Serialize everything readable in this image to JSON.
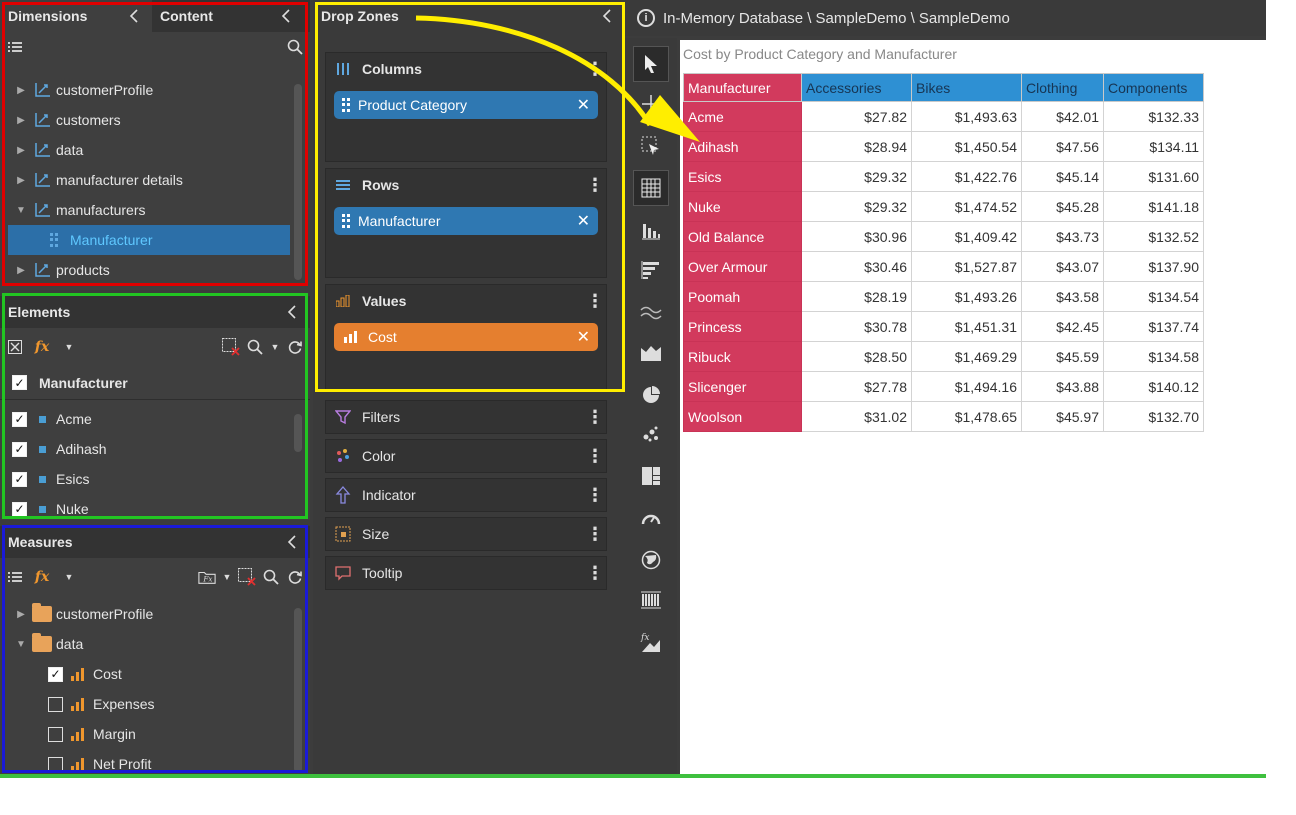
{
  "dimensions": {
    "tab_dimensions": "Dimensions",
    "tab_content": "Content",
    "tree": [
      {
        "label": "customerProfile",
        "expanded": false
      },
      {
        "label": "customers",
        "expanded": false
      },
      {
        "label": "data",
        "expanded": false
      },
      {
        "label": "manufacturer details",
        "expanded": false
      },
      {
        "label": "manufacturers",
        "expanded": true
      },
      {
        "label": "Manufacturer",
        "child": true,
        "selected": true
      },
      {
        "label": "products",
        "expanded": false
      }
    ]
  },
  "elements": {
    "title": "Elements",
    "header_label": "Manufacturer",
    "items": [
      "Acme",
      "Adihash",
      "Esics",
      "Nuke"
    ]
  },
  "measures": {
    "title": "Measures",
    "tree": [
      {
        "label": "customerProfile",
        "type": "folder"
      },
      {
        "label": "data",
        "type": "folder"
      },
      {
        "label": "Cost",
        "type": "measure",
        "checked": true
      },
      {
        "label": "Expenses",
        "type": "measure",
        "checked": false
      },
      {
        "label": "Margin",
        "type": "measure",
        "checked": false
      },
      {
        "label": "Net Profit",
        "type": "measure",
        "checked": false
      }
    ]
  },
  "dropzones": {
    "title": "Drop Zones",
    "columns": {
      "label": "Columns",
      "pill": "Product Category"
    },
    "rows": {
      "label": "Rows",
      "pill": "Manufacturer"
    },
    "values": {
      "label": "Values",
      "pill": "Cost"
    },
    "slots": [
      "Filters",
      "Color",
      "Indicator",
      "Size",
      "Tooltip"
    ]
  },
  "canvas": {
    "breadcrumb": "In-Memory Database \\ SampleDemo \\ SampleDemo",
    "report_title": "Cost by Product Category and Manufacturer"
  },
  "chart_data": {
    "type": "table",
    "title": "Cost by Product Category and Manufacturer",
    "row_header": "Manufacturer",
    "columns": [
      "Accessories",
      "Bikes",
      "Clothing",
      "Components"
    ],
    "rows": [
      {
        "label": "Acme",
        "values": [
          "$27.82",
          "$1,493.63",
          "$42.01",
          "$132.33"
        ]
      },
      {
        "label": "Adihash",
        "values": [
          "$28.94",
          "$1,450.54",
          "$47.56",
          "$134.11"
        ]
      },
      {
        "label": "Esics",
        "values": [
          "$29.32",
          "$1,422.76",
          "$45.14",
          "$131.60"
        ]
      },
      {
        "label": "Nuke",
        "values": [
          "$29.32",
          "$1,474.52",
          "$45.28",
          "$141.18"
        ]
      },
      {
        "label": "Old Balance",
        "values": [
          "$30.96",
          "$1,409.42",
          "$43.73",
          "$132.52"
        ]
      },
      {
        "label": "Over Armour",
        "values": [
          "$30.46",
          "$1,527.87",
          "$43.07",
          "$137.90"
        ]
      },
      {
        "label": "Poomah",
        "values": [
          "$28.19",
          "$1,493.26",
          "$43.58",
          "$134.54"
        ]
      },
      {
        "label": "Princess",
        "values": [
          "$30.78",
          "$1,451.31",
          "$42.45",
          "$137.74"
        ]
      },
      {
        "label": "Ribuck",
        "values": [
          "$28.50",
          "$1,469.29",
          "$45.59",
          "$134.58"
        ]
      },
      {
        "label": "Slicenger",
        "values": [
          "$27.78",
          "$1,494.16",
          "$43.88",
          "$140.12"
        ]
      },
      {
        "label": "Woolson",
        "values": [
          "$31.02",
          "$1,478.65",
          "$45.97",
          "$132.70"
        ]
      }
    ]
  },
  "colors": {
    "header_blue": "#2e90d3",
    "row_header_red": "#d23a5d",
    "pill_blue": "#2f78b2",
    "pill_orange": "#e57f2f",
    "annotation_red": "#e00000",
    "annotation_green": "#22c522",
    "annotation_blue": "#1a1ad8",
    "annotation_yellow": "#ffee00"
  }
}
